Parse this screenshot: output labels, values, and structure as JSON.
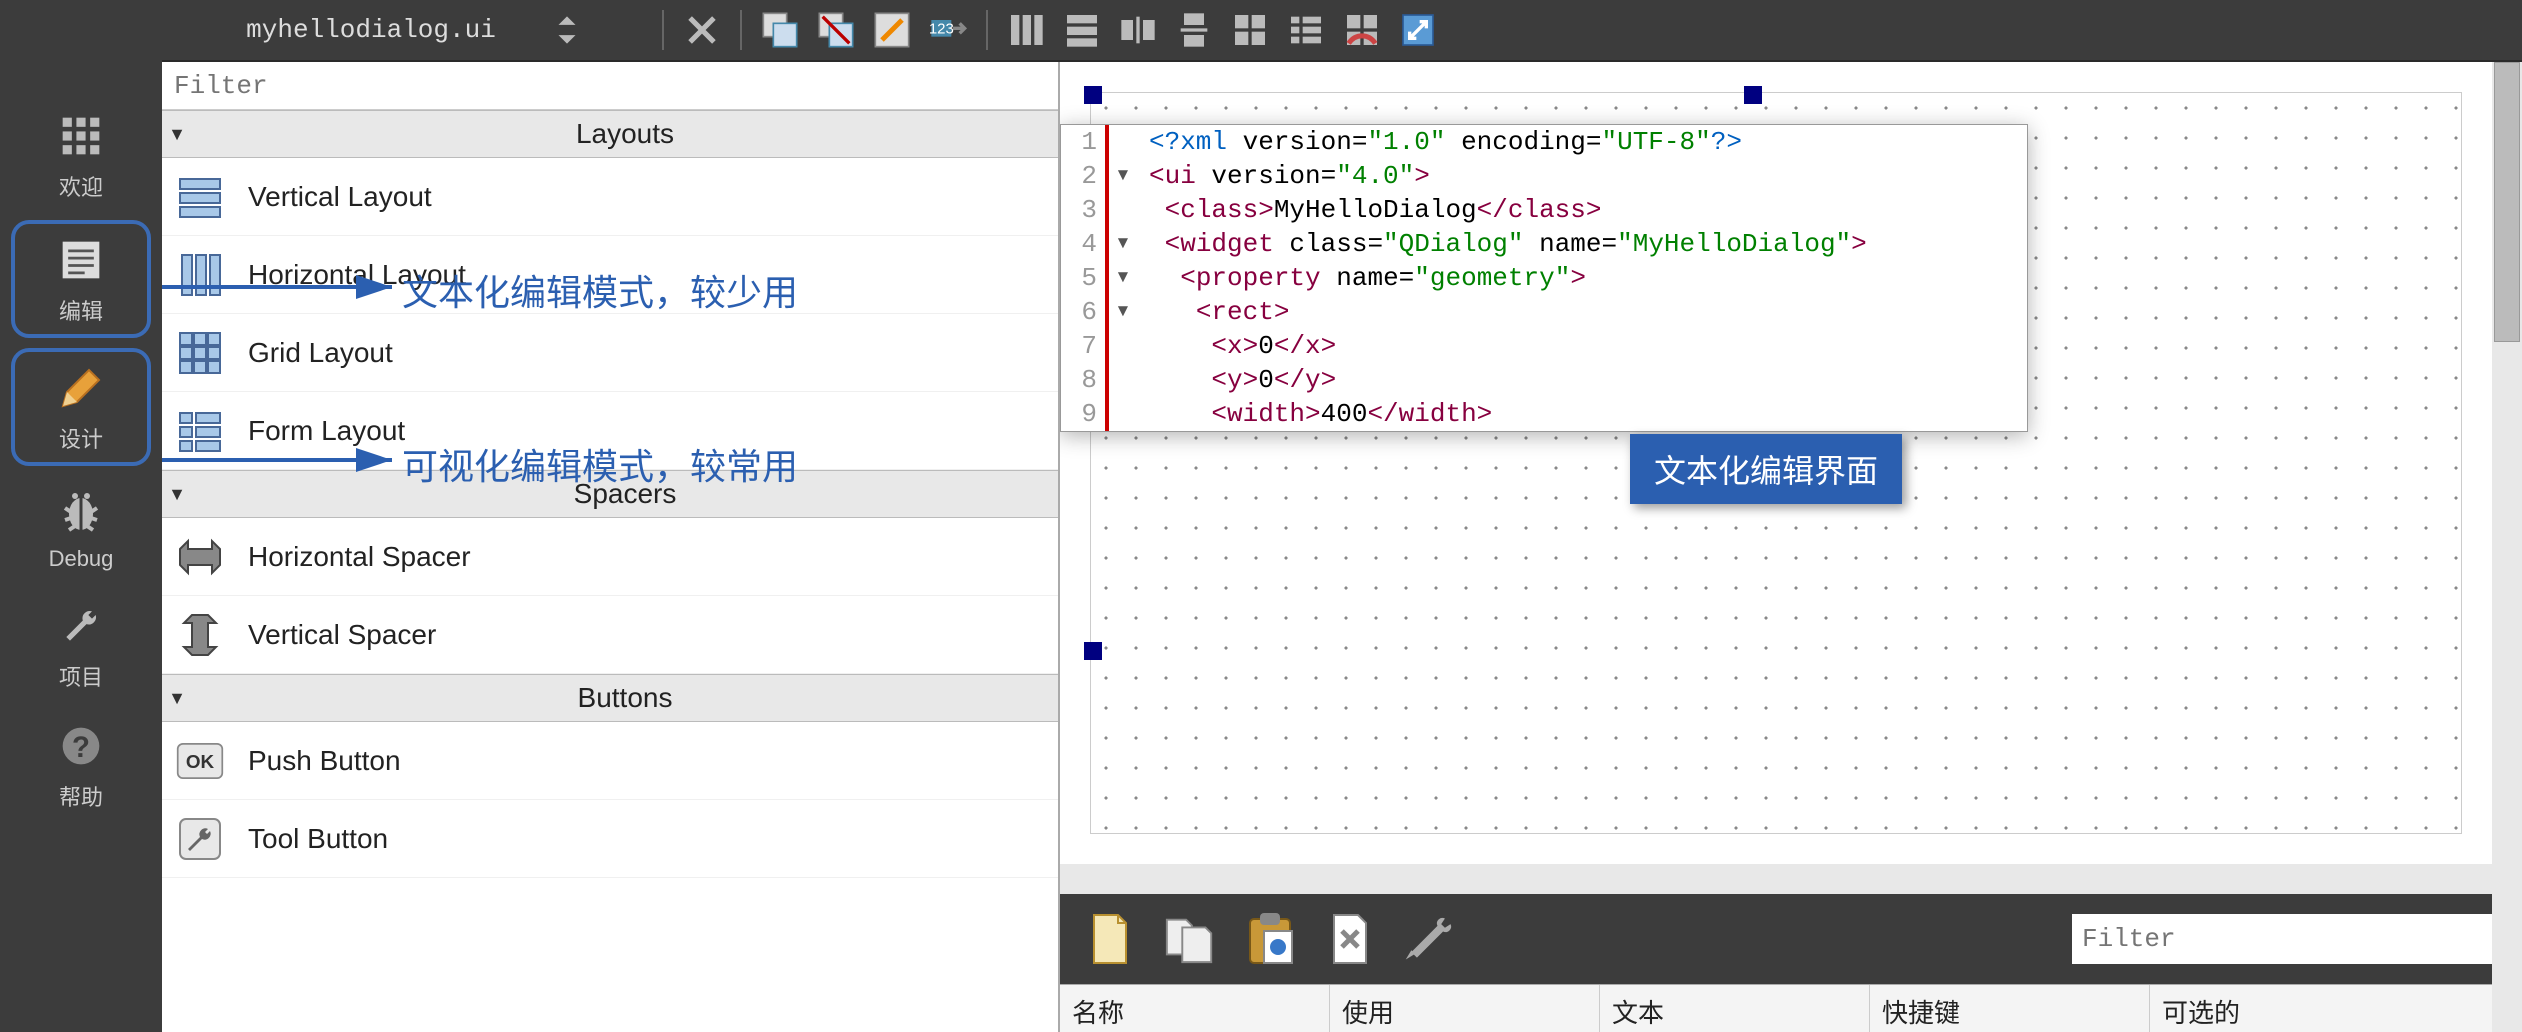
{
  "sidebar": {
    "items": [
      {
        "label": "欢迎"
      },
      {
        "label": "编辑"
      },
      {
        "label": "设计"
      },
      {
        "label": "Debug"
      },
      {
        "label": "项目"
      },
      {
        "label": "帮助"
      }
    ]
  },
  "topbar": {
    "filename": "myhellodialog.ui"
  },
  "widgetbox": {
    "filter_placeholder": "Filter",
    "sections": [
      {
        "title": "Layouts",
        "items": [
          {
            "label": "Vertical Layout"
          },
          {
            "label": "Horizontal Layout"
          },
          {
            "label": "Grid Layout"
          },
          {
            "label": "Form Layout"
          }
        ]
      },
      {
        "title": "Spacers",
        "items": [
          {
            "label": "Horizontal Spacer"
          },
          {
            "label": "Vertical Spacer"
          }
        ]
      },
      {
        "title": "Buttons",
        "items": [
          {
            "label": "Push Button"
          },
          {
            "label": "Tool Button"
          }
        ]
      }
    ]
  },
  "annotations": {
    "edit_note": "文本化编辑模式，较少用",
    "design_note": "可视化编辑模式，较常用",
    "badge": "文本化编辑界面"
  },
  "code": {
    "lines": [
      {
        "n": "1",
        "fold": "",
        "html": "<span class='xml-decl'>&lt;?xml</span> version=<span class='xml-val'>\"1.0\"</span> encoding=<span class='xml-val'>\"UTF-8\"</span><span class='xml-decl'>?&gt;</span>"
      },
      {
        "n": "2",
        "fold": "▾",
        "html": "<span class='xml-tag'>&lt;ui</span> version=<span class='xml-val'>\"4.0\"</span><span class='xml-tag'>&gt;</span>"
      },
      {
        "n": "3",
        "fold": "",
        "html": " <span class='xml-tag'>&lt;class&gt;</span>MyHelloDialog<span class='xml-tag'>&lt;/class&gt;</span>"
      },
      {
        "n": "4",
        "fold": "▾",
        "html": " <span class='xml-tag'>&lt;widget</span> class=<span class='xml-val'>\"QDialog\"</span> name=<span class='xml-val'>\"MyHelloDialog\"</span><span class='xml-tag'>&gt;</span>"
      },
      {
        "n": "5",
        "fold": "▾",
        "html": "  <span class='xml-tag'>&lt;property</span> name=<span class='xml-val'>\"geometry\"</span><span class='xml-tag'>&gt;</span>"
      },
      {
        "n": "6",
        "fold": "▾",
        "html": "   <span class='xml-tag'>&lt;rect&gt;</span>"
      },
      {
        "n": "7",
        "fold": "",
        "html": "    <span class='xml-tag'>&lt;x&gt;</span>0<span class='xml-tag'>&lt;/x&gt;</span>"
      },
      {
        "n": "8",
        "fold": "",
        "html": "    <span class='xml-tag'>&lt;y&gt;</span>0<span class='xml-tag'>&lt;/y&gt;</span>"
      },
      {
        "n": "9",
        "fold": "",
        "html": "    <span class='xml-tag'>&lt;width&gt;</span>400<span class='xml-tag'>&lt;/width&gt;</span>"
      }
    ]
  },
  "actions_table": {
    "filter_placeholder": "Filter",
    "columns": [
      "名称",
      "使用",
      "文本",
      "快捷键",
      "可选的"
    ]
  }
}
